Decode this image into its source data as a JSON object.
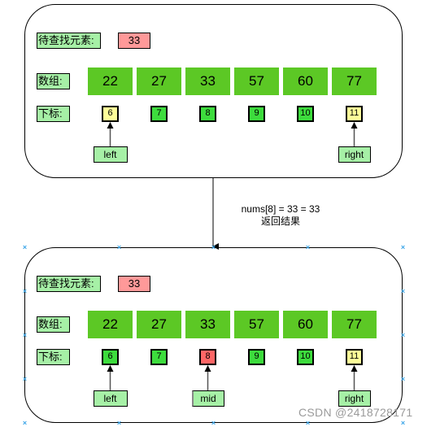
{
  "panels": [
    {
      "target_label": "待查找元素:",
      "target_value": "33",
      "array_label": "数组:",
      "index_label": "下标:",
      "array": [
        "22",
        "27",
        "33",
        "57",
        "60",
        "77"
      ],
      "indices": [
        {
          "value": "6",
          "state": "yellow"
        },
        {
          "value": "7",
          "state": "green"
        },
        {
          "value": "8",
          "state": "green"
        },
        {
          "value": "9",
          "state": "green"
        },
        {
          "value": "10",
          "state": "green"
        },
        {
          "value": "11",
          "state": "yellow"
        }
      ],
      "pointers": [
        {
          "label": "left",
          "index_position": 0
        },
        {
          "label": "right",
          "index_position": 5
        }
      ]
    },
    {
      "target_label": "待查找元素:",
      "target_value": "33",
      "array_label": "数组:",
      "index_label": "下标:",
      "array": [
        "22",
        "27",
        "33",
        "57",
        "60",
        "77"
      ],
      "indices": [
        {
          "value": "6",
          "state": "green"
        },
        {
          "value": "7",
          "state": "green"
        },
        {
          "value": "8",
          "state": "red"
        },
        {
          "value": "9",
          "state": "green"
        },
        {
          "value": "10",
          "state": "green"
        },
        {
          "value": "11",
          "state": "yellow"
        }
      ],
      "pointers": [
        {
          "label": "left",
          "index_position": 0
        },
        {
          "label": "mid",
          "index_position": 2
        },
        {
          "label": "right",
          "index_position": 5
        }
      ]
    }
  ],
  "transition": {
    "line1": "nums[8] = 33 = 33",
    "line2": "返回结果"
  },
  "watermark": "CSDN @2418728171",
  "colors": {
    "label_bg": "#a6f0a6",
    "target_bg": "#ff9999",
    "array_cell": "#5cc825",
    "index_green": "#3ddc3d",
    "index_yellow": "#ffff99",
    "index_red": "#ff6666",
    "selection_marker": "#3aa5e8"
  }
}
